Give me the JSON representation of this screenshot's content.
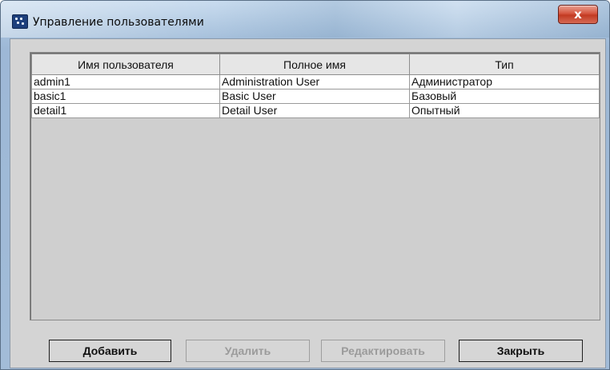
{
  "window": {
    "title": "Управление пользователями",
    "close_glyph": "x"
  },
  "table": {
    "columns": [
      "Имя пользователя",
      "Полное имя",
      "Тип"
    ],
    "rows": [
      [
        "admin1",
        "Administration User",
        "Администратор"
      ],
      [
        "basic1",
        "Basic User",
        "Базовый"
      ],
      [
        "detail1",
        "Detail User",
        "Опытный"
      ]
    ]
  },
  "buttons": {
    "add": "Добавить",
    "delete": "Удалить",
    "edit": "Редактировать",
    "close": "Закрыть"
  }
}
